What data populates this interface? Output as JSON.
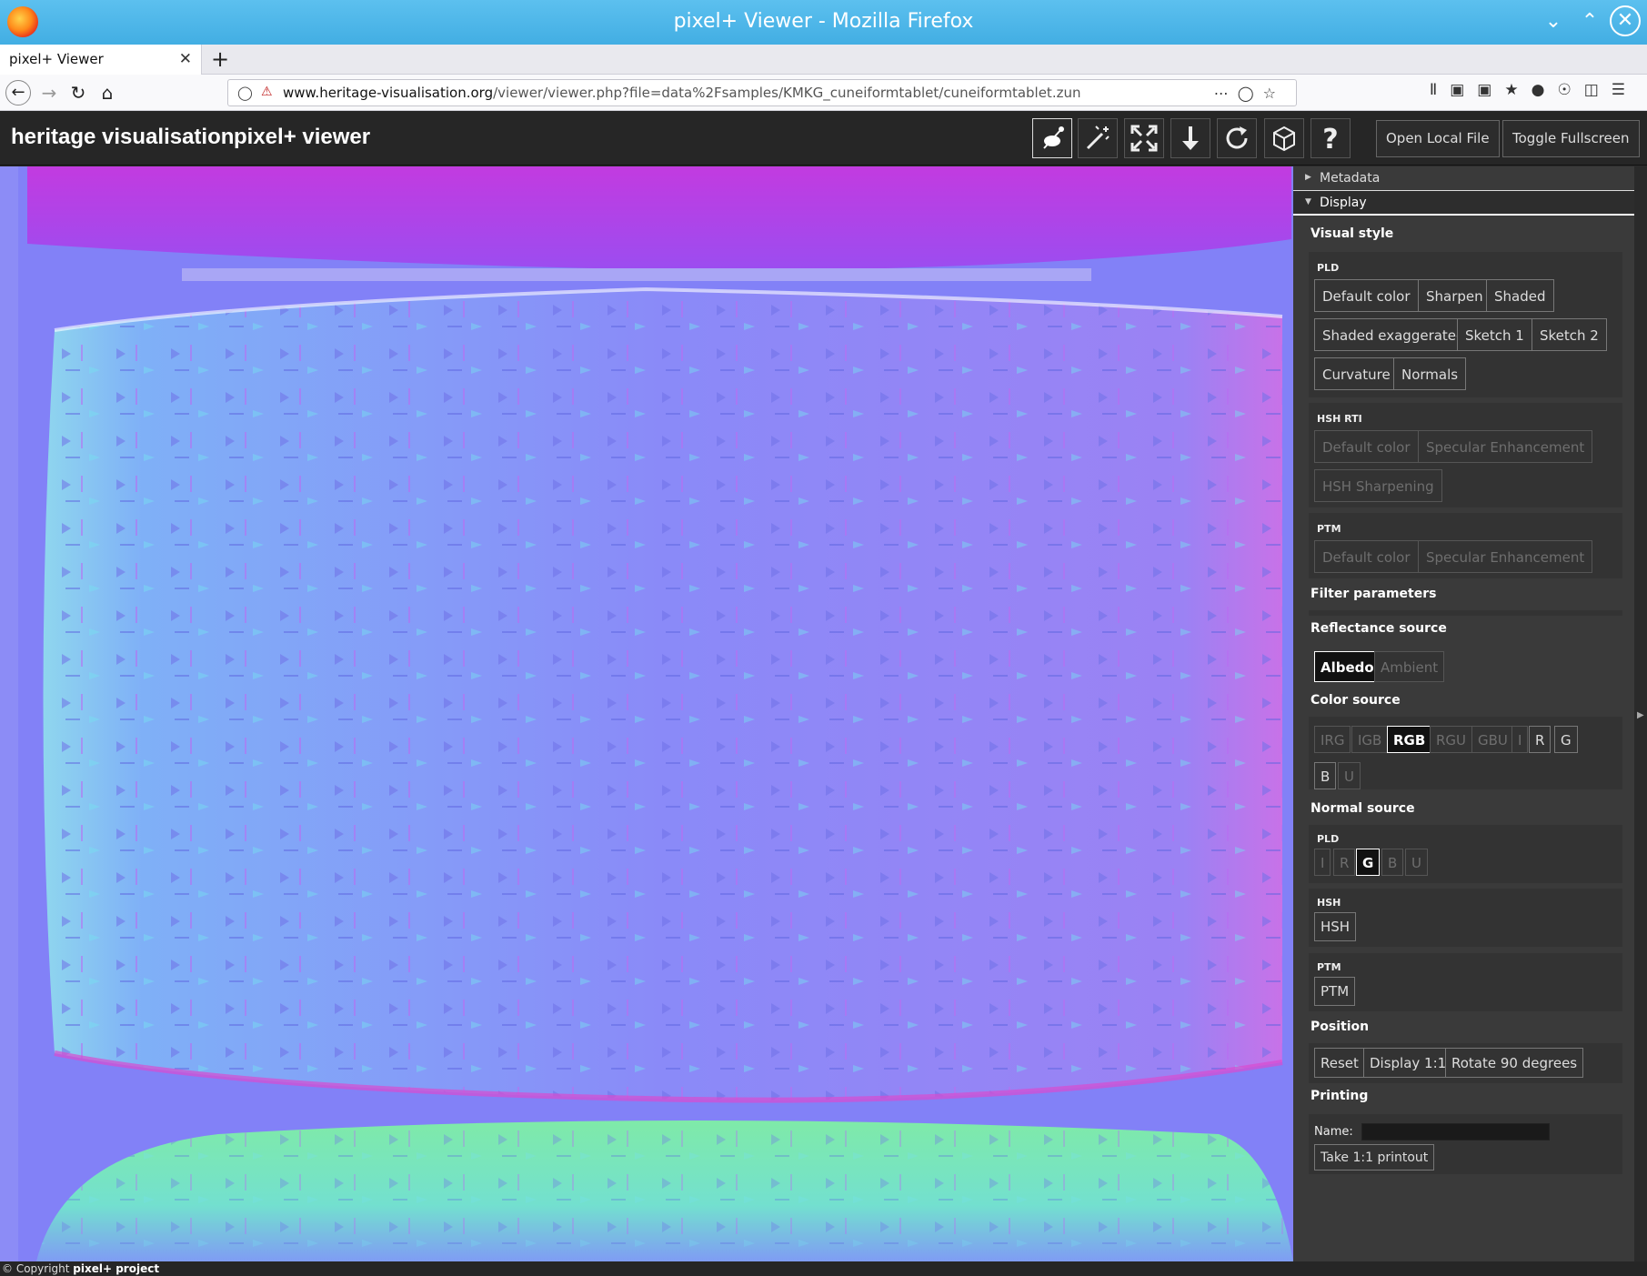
{
  "window": {
    "title": "pixel+ Viewer - Mozilla Firefox"
  },
  "tabs": [
    {
      "label": "pixel+ Viewer"
    }
  ],
  "address": {
    "host": "www.heritage-visualisation.org",
    "path": "/viewer/viewer.php?file=data%2Fsamples/KMKG_cuneiformtablet/cuneiformtablet.zun"
  },
  "header": {
    "brand": "heritage visualisation",
    "app_title": "pixel+ viewer",
    "tool_icons": [
      "light-direction-icon",
      "magic-wand-icon",
      "expand-icon",
      "download-icon",
      "rotate-icon",
      "3d-box-icon",
      "help-icon"
    ],
    "open_local_label": "Open Local File",
    "fullscreen_label": "Toggle Fullscreen"
  },
  "panel": {
    "metadata_label": "Metadata",
    "display_label": "Display",
    "visual_style_label": "Visual style",
    "pld": {
      "label": "PLD",
      "buttons": [
        "Default color",
        "Sharpen",
        "Shaded",
        "Shaded exaggerated",
        "Sketch 1",
        "Sketch 2",
        "Curvature",
        "Normals"
      ]
    },
    "hsh_rti": {
      "label": "HSH RTI",
      "buttons": [
        "Default color",
        "Specular Enhancement",
        "HSH Sharpening"
      ]
    },
    "ptm": {
      "label": "PTM",
      "buttons": [
        "Default color",
        "Specular Enhancement"
      ]
    },
    "filter_params_label": "Filter parameters",
    "reflectance_label": "Reflectance source",
    "reflectance_buttons": [
      "Albedo",
      "Ambient"
    ],
    "reflectance_selected": "Albedo",
    "color_source_label": "Color source",
    "color_source_buttons": [
      "IRG",
      "IGB",
      "RGB",
      "RGU",
      "GBU",
      "I",
      "R",
      "G",
      "B",
      "U"
    ],
    "color_source_selected": "RGB",
    "normal_source_label": "Normal source",
    "normal_pld_label": "PLD",
    "normal_pld_buttons": [
      "I",
      "R",
      "G",
      "B",
      "U"
    ],
    "normal_pld_selected": "G",
    "normal_hsh_label": "HSH",
    "normal_hsh_button": "HSH",
    "normal_ptm_label": "PTM",
    "normal_ptm_button": "PTM",
    "position_label": "Position",
    "position_buttons": [
      "Reset",
      "Display 1:1",
      "Rotate 90 degrees"
    ],
    "printing_label": "Printing",
    "name_label": "Name:",
    "name_value": "",
    "printout_label": "Take 1:1 printout"
  },
  "footer": {
    "prefix": "© Copyright",
    "project": "pixel+ project"
  },
  "colors": {
    "accent_bar": "#42aee3",
    "app_dark": "#262626",
    "panel_bg": "#3a3a3a"
  }
}
